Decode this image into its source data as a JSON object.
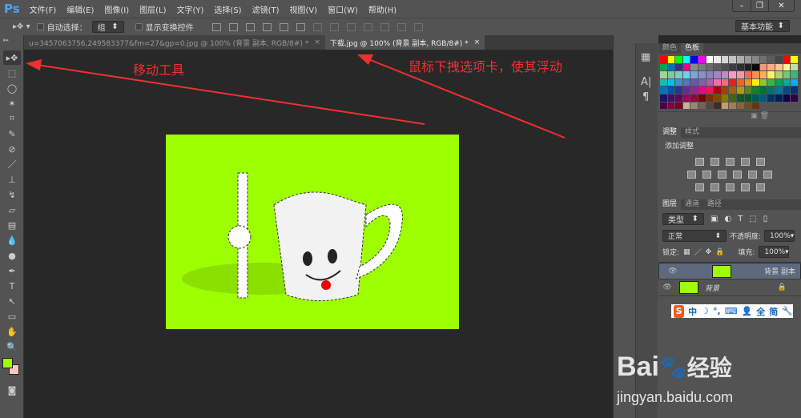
{
  "app": {
    "logo": "Ps",
    "menus": [
      "文件(F)",
      "编辑(E)",
      "图像(I)",
      "图层(L)",
      "文字(Y)",
      "选择(S)",
      "滤镜(T)",
      "视图(V)",
      "窗口(W)",
      "帮助(H)"
    ],
    "window_buttons": [
      "–",
      "❐",
      "✕"
    ]
  },
  "options": {
    "auto_select_label": "自动选择：",
    "auto_select_value": "组",
    "show_transform_label": "显示变换控件",
    "workspace": "基本功能"
  },
  "tabs": [
    {
      "label": "u=3457063756,249583377&fm=27&gp=0.jpg @ 100% (背景 副本, RGB/8#) *",
      "close": "×"
    },
    {
      "label": "下载.jpg @ 100% (背景 副本, RGB/8#) *",
      "close": "×"
    }
  ],
  "annotations": {
    "move_tool": "移动工具",
    "drag_tab": "鼠标下拽选项卡，使其浮动"
  },
  "colors": {
    "foreground": "#9dff00",
    "background": "#f6c8b8",
    "canvas_bg": "#9dff00",
    "annotation": "#f03030"
  },
  "panels": {
    "color_tabs": [
      "颜色",
      "色板"
    ],
    "swatches": [
      "#ff0000",
      "#ffff00",
      "#00ff00",
      "#00ffff",
      "#0000ff",
      "#ff00ff",
      "#ffffff",
      "#ebebeb",
      "#d6d6d6",
      "#c2c2c2",
      "#adadad",
      "#999999",
      "#858585",
      "#707070",
      "#5c5c5c",
      "#474747",
      "#ff0000",
      "#ffff00",
      "#00a651",
      "#0072bc",
      "#2e3192",
      "#ec008c",
      "#8a8a8a",
      "#7a7a7a",
      "#6b6b6b",
      "#5c5c5c",
      "#4d4d4d",
      "#3d3d3d",
      "#2e2e2e",
      "#1f1f1f",
      "#000000",
      "#f7977a",
      "#fbad82",
      "#fdc68c",
      "#fff799",
      "#c4df9b",
      "#a3d39c",
      "#82ca9c",
      "#7accc8",
      "#6dcff6",
      "#7da7d9",
      "#8493ca",
      "#8882be",
      "#a187be",
      "#bc8dbf",
      "#f49ac2",
      "#f6989d",
      "#f26c4f",
      "#f68e56",
      "#fbaf5c",
      "#fff468",
      "#acd372",
      "#7cc576",
      "#3bb878",
      "#1abbb4",
      "#00bff3",
      "#438ccb",
      "#5574b9",
      "#605ca8",
      "#855fa8",
      "#a763a8",
      "#f06ea9",
      "#f26d7d",
      "#ed1c24",
      "#f26522",
      "#f7941d",
      "#fff200",
      "#8dc73f",
      "#39b54a",
      "#00a651",
      "#00a99d",
      "#00aeef",
      "#0072bc",
      "#0054a6",
      "#2e3192",
      "#662d91",
      "#92278f",
      "#ec008c",
      "#ed145b",
      "#9e0b0f",
      "#a0410d",
      "#a3620a",
      "#aba000",
      "#598527",
      "#197b30",
      "#007236",
      "#00746b",
      "#0076a3",
      "#004b80",
      "#003471",
      "#1b1464",
      "#440e62",
      "#630460",
      "#9e005d",
      "#9e0039",
      "#790000",
      "#7b2e00",
      "#7d4900",
      "#827b00",
      "#406618",
      "#005e20",
      "#005826",
      "#005952",
      "#005b7f",
      "#003663",
      "#002157",
      "#0d004c",
      "#32004b",
      "#4b0049",
      "#7b0046",
      "#7a0026",
      "#c7b299",
      "#998675",
      "#736357",
      "#534741",
      "#37302a",
      "#c69c6d",
      "#a67c52",
      "#8c6239",
      "#754c24",
      "#603913"
    ],
    "adjust_tabs": [
      "调整",
      "样式"
    ],
    "adjust_title": "添加调整",
    "layers_tabs": [
      "图层",
      "通道",
      "路径"
    ],
    "filter_kind": "类型",
    "blend_mode": "正常",
    "opacity_label": "不透明度:",
    "opacity": "100%",
    "lock_label": "锁定:",
    "fill_label": "填充:",
    "fill": "100%",
    "layers": [
      {
        "name": "背景 副本",
        "selected": true
      },
      {
        "name": "背景",
        "selected": false,
        "locked": true
      }
    ]
  },
  "ime": {
    "logo": "S",
    "items": [
      "中",
      "☽",
      "°,",
      "⌨",
      "👤",
      "全",
      "简",
      "🔧"
    ]
  },
  "watermark": {
    "brand": "Bai",
    "paw": "🐾",
    "suffix": "经验",
    "url": "jingyan.baidu.com"
  }
}
